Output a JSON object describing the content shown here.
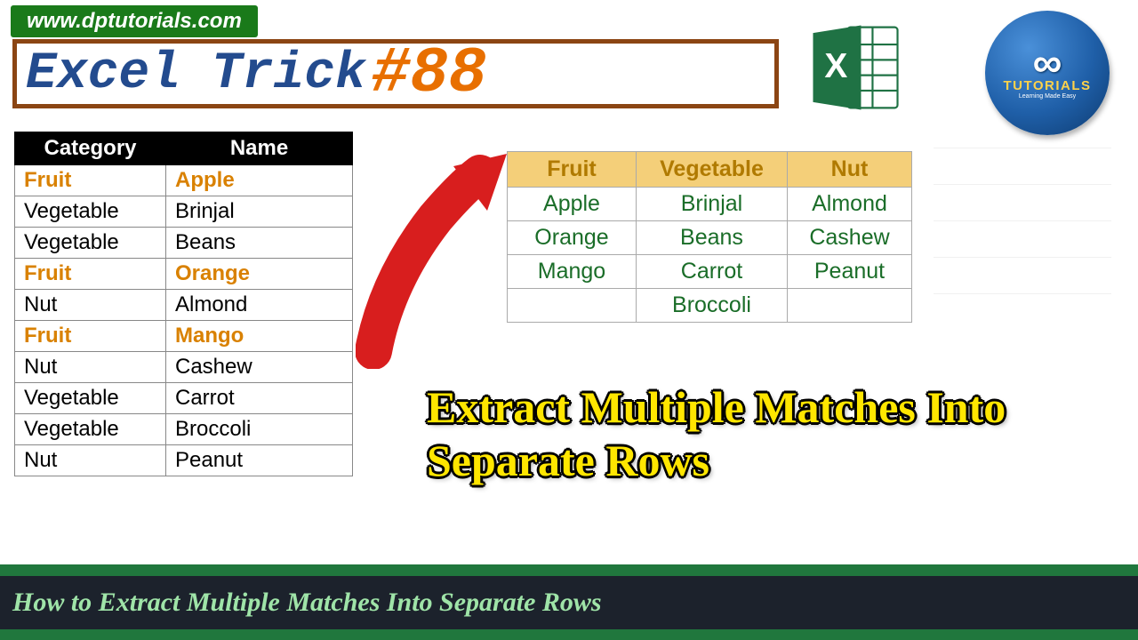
{
  "url": "www.dptutorials.com",
  "title_text": "Excel Trick",
  "title_number": "#88",
  "logo": {
    "main": "∞",
    "label": "TUTORIALS",
    "sub": "Learning Made Easy"
  },
  "source_table": {
    "headers": [
      "Category",
      "Name"
    ],
    "rows": [
      {
        "cat": "Fruit",
        "name": "Apple",
        "hl": true
      },
      {
        "cat": "Vegetable",
        "name": "Brinjal",
        "hl": false
      },
      {
        "cat": "Vegetable",
        "name": "Beans",
        "hl": false
      },
      {
        "cat": "Fruit",
        "name": "Orange",
        "hl": true
      },
      {
        "cat": "Nut",
        "name": "Almond",
        "hl": false
      },
      {
        "cat": "Fruit",
        "name": "Mango",
        "hl": true
      },
      {
        "cat": "Nut",
        "name": "Cashew",
        "hl": false
      },
      {
        "cat": "Vegetable",
        "name": "Carrot",
        "hl": false
      },
      {
        "cat": "Vegetable",
        "name": "Broccoli",
        "hl": false
      },
      {
        "cat": "Nut",
        "name": "Peanut",
        "hl": false
      }
    ]
  },
  "result_table": {
    "headers": [
      "Fruit",
      "Vegetable",
      "Nut"
    ],
    "rows": [
      [
        "Apple",
        "Brinjal",
        "Almond"
      ],
      [
        "Orange",
        "Beans",
        "Cashew"
      ],
      [
        "Mango",
        "Carrot",
        "Peanut"
      ],
      [
        "",
        "Broccoli",
        ""
      ]
    ]
  },
  "subtitle": "Extract Multiple Matches Into Separate Rows",
  "footer": "How to Extract Multiple Matches Into Separate Rows"
}
